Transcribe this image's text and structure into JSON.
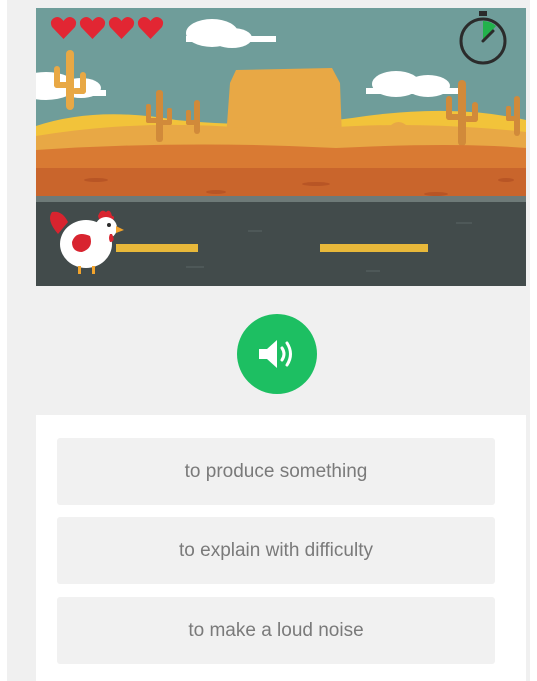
{
  "game": {
    "lives": 4,
    "max_lives": 4,
    "player": "chicken",
    "timer_icon": "stopwatch-icon",
    "colors": {
      "sky": "#6f9d9a",
      "desert": "#e8a845",
      "sand": "#f2c33a",
      "ground": "#c9652c",
      "road": "#424b4b",
      "road_stripe": "#e8b83a",
      "heart": "#e22633",
      "sound_button": "#1dbf62"
    }
  },
  "audio": {
    "icon": "speaker-icon"
  },
  "answers": [
    {
      "label": "to produce something"
    },
    {
      "label": "to explain with difficulty"
    },
    {
      "label": "to make a loud noise"
    }
  ]
}
